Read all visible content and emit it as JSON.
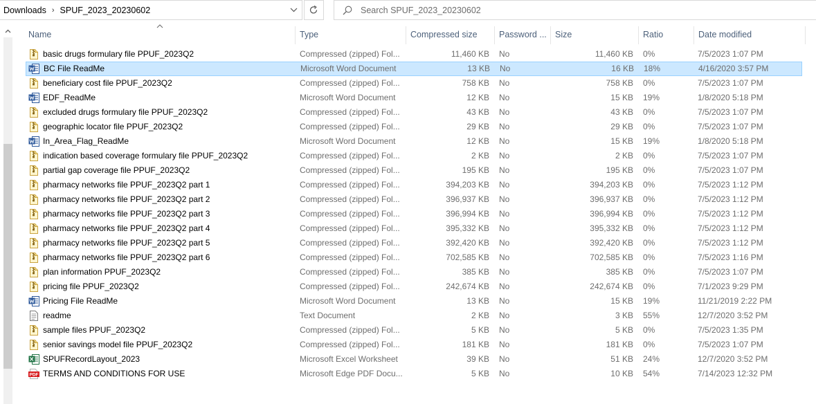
{
  "breadcrumb": {
    "items": [
      "Downloads",
      "SPUF_2023_20230602"
    ],
    "separator": "›"
  },
  "search": {
    "placeholder": "Search SPUF_2023_20230602"
  },
  "columns": {
    "name": "Name",
    "type": "Type",
    "compressed_size": "Compressed size",
    "password": "Password ...",
    "size": "Size",
    "ratio": "Ratio",
    "date_modified": "Date modified"
  },
  "colors": {
    "selection_bg": "#cce8ff",
    "selection_border": "#99d1ff",
    "header_text": "#4c607a",
    "secondary_text": "#6d6d6d"
  },
  "files": [
    {
      "name": "basic drugs formulary file  PPUF_2023Q2",
      "icon": "zip-folder-icon",
      "type": "Compressed (zipped) Fol...",
      "compressed_size": "11,460 KB",
      "password": "No",
      "size": "11,460 KB",
      "ratio": "0%",
      "date": "7/5/2023 1:07 PM",
      "selected": false
    },
    {
      "name": "BC File ReadMe",
      "icon": "word-document-icon",
      "type": "Microsoft Word Document",
      "compressed_size": "13 KB",
      "password": "No",
      "size": "16 KB",
      "ratio": "18%",
      "date": "4/16/2020 3:57 PM",
      "selected": true
    },
    {
      "name": "beneficiary cost file  PPUF_2023Q2",
      "icon": "zip-folder-icon",
      "type": "Compressed (zipped) Fol...",
      "compressed_size": "758 KB",
      "password": "No",
      "size": "758 KB",
      "ratio": "0%",
      "date": "7/5/2023 1:07 PM",
      "selected": false
    },
    {
      "name": "EDF_ReadMe",
      "icon": "word-document-icon",
      "type": "Microsoft Word Document",
      "compressed_size": "12 KB",
      "password": "No",
      "size": "15 KB",
      "ratio": "19%",
      "date": "1/8/2020 5:18 PM",
      "selected": false
    },
    {
      "name": "excluded drugs formulary file  PPUF_2023Q2",
      "icon": "zip-folder-icon",
      "type": "Compressed (zipped) Fol...",
      "compressed_size": "43 KB",
      "password": "No",
      "size": "43 KB",
      "ratio": "0%",
      "date": "7/5/2023 1:07 PM",
      "selected": false
    },
    {
      "name": "geographic locator file  PPUF_2023Q2",
      "icon": "zip-folder-icon",
      "type": "Compressed (zipped) Fol...",
      "compressed_size": "29 KB",
      "password": "No",
      "size": "29 KB",
      "ratio": "0%",
      "date": "7/5/2023 1:07 PM",
      "selected": false
    },
    {
      "name": "In_Area_Flag_ReadMe",
      "icon": "word-document-icon",
      "type": "Microsoft Word Document",
      "compressed_size": "12 KB",
      "password": "No",
      "size": "15 KB",
      "ratio": "19%",
      "date": "1/8/2020 5:18 PM",
      "selected": false
    },
    {
      "name": "indication based coverage formulary file  PPUF_2023Q2",
      "icon": "zip-folder-icon",
      "type": "Compressed (zipped) Fol...",
      "compressed_size": "2 KB",
      "password": "No",
      "size": "2 KB",
      "ratio": "0%",
      "date": "7/5/2023 1:07 PM",
      "selected": false
    },
    {
      "name": "partial gap coverage file  PPUF_2023Q2",
      "icon": "zip-folder-icon",
      "type": "Compressed (zipped) Fol...",
      "compressed_size": "195 KB",
      "password": "No",
      "size": "195 KB",
      "ratio": "0%",
      "date": "7/5/2023 1:07 PM",
      "selected": false
    },
    {
      "name": "pharmacy networks file  PPUF_2023Q2 part 1",
      "icon": "zip-folder-icon",
      "type": "Compressed (zipped) Fol...",
      "compressed_size": "394,203 KB",
      "password": "No",
      "size": "394,203 KB",
      "ratio": "0%",
      "date": "7/5/2023 1:12 PM",
      "selected": false
    },
    {
      "name": "pharmacy networks file  PPUF_2023Q2 part 2",
      "icon": "zip-folder-icon",
      "type": "Compressed (zipped) Fol...",
      "compressed_size": "396,937 KB",
      "password": "No",
      "size": "396,937 KB",
      "ratio": "0%",
      "date": "7/5/2023 1:12 PM",
      "selected": false
    },
    {
      "name": "pharmacy networks file  PPUF_2023Q2 part 3",
      "icon": "zip-folder-icon",
      "type": "Compressed (zipped) Fol...",
      "compressed_size": "396,994 KB",
      "password": "No",
      "size": "396,994 KB",
      "ratio": "0%",
      "date": "7/5/2023 1:12 PM",
      "selected": false
    },
    {
      "name": "pharmacy networks file  PPUF_2023Q2 part 4",
      "icon": "zip-folder-icon",
      "type": "Compressed (zipped) Fol...",
      "compressed_size": "395,332 KB",
      "password": "No",
      "size": "395,332 KB",
      "ratio": "0%",
      "date": "7/5/2023 1:12 PM",
      "selected": false
    },
    {
      "name": "pharmacy networks file  PPUF_2023Q2 part 5",
      "icon": "zip-folder-icon",
      "type": "Compressed (zipped) Fol...",
      "compressed_size": "392,420 KB",
      "password": "No",
      "size": "392,420 KB",
      "ratio": "0%",
      "date": "7/5/2023 1:12 PM",
      "selected": false
    },
    {
      "name": "pharmacy networks file  PPUF_2023Q2 part 6",
      "icon": "zip-folder-icon",
      "type": "Compressed (zipped) Fol...",
      "compressed_size": "702,585 KB",
      "password": "No",
      "size": "702,585 KB",
      "ratio": "0%",
      "date": "7/5/2023 1:16 PM",
      "selected": false
    },
    {
      "name": "plan information  PPUF_2023Q2",
      "icon": "zip-folder-icon",
      "type": "Compressed (zipped) Fol...",
      "compressed_size": "385 KB",
      "password": "No",
      "size": "385 KB",
      "ratio": "0%",
      "date": "7/5/2023 1:07 PM",
      "selected": false
    },
    {
      "name": "pricing file PPUF_2023Q2",
      "icon": "zip-folder-icon",
      "type": "Compressed (zipped) Fol...",
      "compressed_size": "242,674 KB",
      "password": "No",
      "size": "242,674 KB",
      "ratio": "0%",
      "date": "7/1/2023 9:29 PM",
      "selected": false
    },
    {
      "name": "Pricing File ReadMe",
      "icon": "word-document-icon",
      "type": "Microsoft Word Document",
      "compressed_size": "13 KB",
      "password": "No",
      "size": "15 KB",
      "ratio": "19%",
      "date": "11/21/2019 2:22 PM",
      "selected": false
    },
    {
      "name": "readme",
      "icon": "text-document-icon",
      "type": "Text Document",
      "compressed_size": "2 KB",
      "password": "No",
      "size": "3 KB",
      "ratio": "55%",
      "date": "12/7/2020 3:52 PM",
      "selected": false
    },
    {
      "name": "sample files PPUF_2023Q2",
      "icon": "zip-folder-icon",
      "type": "Compressed (zipped) Fol...",
      "compressed_size": "5 KB",
      "password": "No",
      "size": "5 KB",
      "ratio": "0%",
      "date": "7/5/2023 1:35 PM",
      "selected": false
    },
    {
      "name": "senior savings model file PPUF_2023Q2",
      "icon": "zip-folder-icon",
      "type": "Compressed (zipped) Fol...",
      "compressed_size": "181 KB",
      "password": "No",
      "size": "181 KB",
      "ratio": "0%",
      "date": "7/5/2023 1:07 PM",
      "selected": false
    },
    {
      "name": "SPUFRecordLayout_2023",
      "icon": "excel-document-icon",
      "type": "Microsoft Excel Worksheet",
      "compressed_size": "39 KB",
      "password": "No",
      "size": "51 KB",
      "ratio": "24%",
      "date": "12/7/2020 3:52 PM",
      "selected": false
    },
    {
      "name": "TERMS AND CONDITIONS FOR USE",
      "icon": "pdf-document-icon",
      "type": "Microsoft Edge PDF Docu...",
      "compressed_size": "5 KB",
      "password": "No",
      "size": "10 KB",
      "ratio": "54%",
      "date": "7/14/2023 12:32 PM",
      "selected": false
    }
  ]
}
